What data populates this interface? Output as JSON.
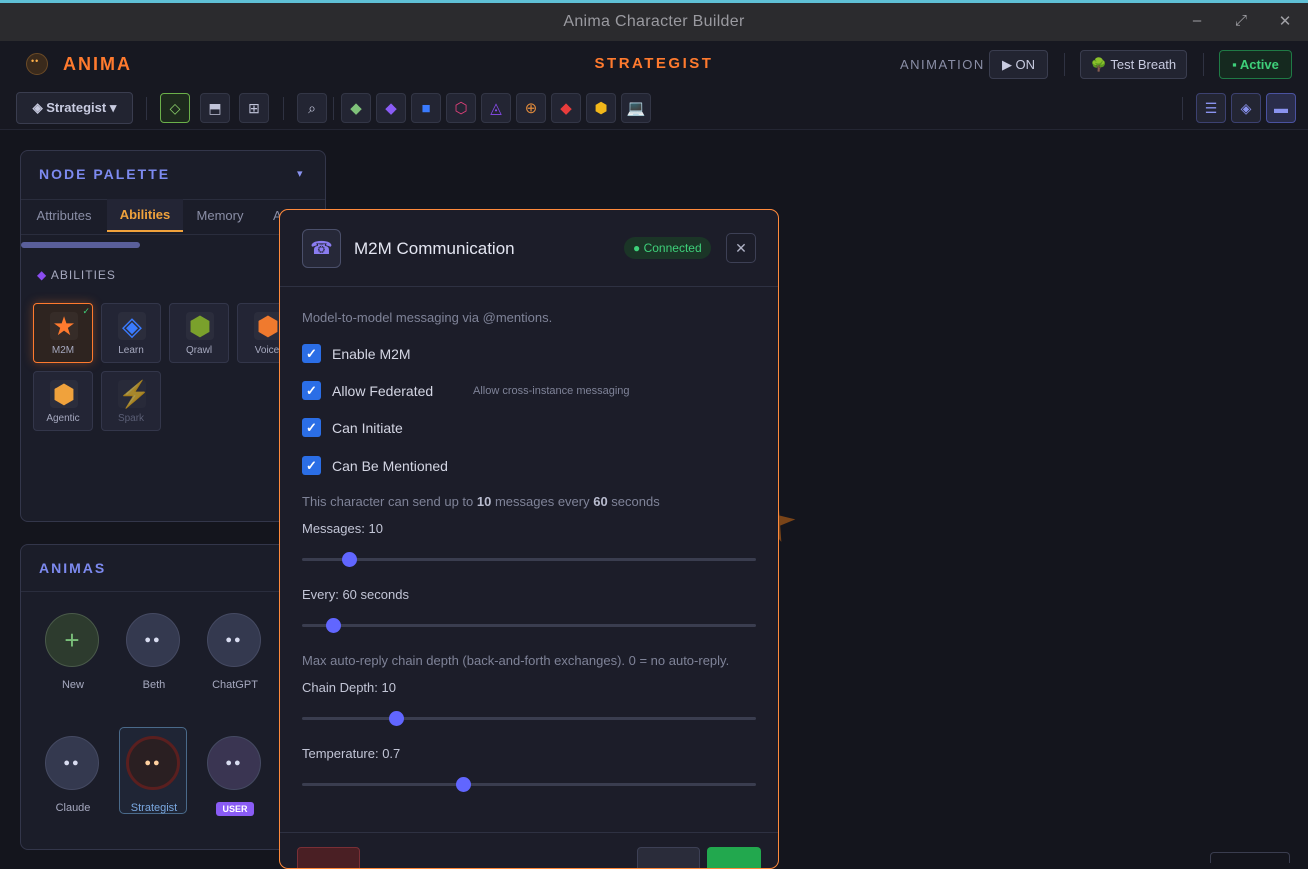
{
  "window": {
    "title": "Anima Character Builder",
    "min_icon": "minimize-icon",
    "max_icon": "maximize-icon",
    "close_icon": "close-icon"
  },
  "header": {
    "brand": "ANIMA",
    "center_title": "STRATEGIST",
    "animation_label": "ANIMATION",
    "animation_toggle": "▶ ON",
    "test_breath": "🌳 Test Breath",
    "status": "▪ Active"
  },
  "toolbar": {
    "character_select": "◈ Strategist ▾",
    "tools": [
      "◇",
      "⬒",
      "⊞",
      "⌕"
    ],
    "node_icons": [
      {
        "name": "green-gem-icon",
        "glyph": "◆",
        "color": "#7fc27a"
      },
      {
        "name": "purple-gem-icon",
        "glyph": "◆",
        "color": "#8a5cf5"
      },
      {
        "name": "blue-square-icon",
        "glyph": "■",
        "color": "#3a7bff"
      },
      {
        "name": "pink-hexagon-icon",
        "glyph": "⬡",
        "color": "#e0407a"
      },
      {
        "name": "violet-triangle-icon",
        "glyph": "◬",
        "color": "#8a4cf0"
      },
      {
        "name": "orange-crosshair-icon",
        "glyph": "⊕",
        "color": "#e08a3c"
      },
      {
        "name": "red-gem-icon",
        "glyph": "◆",
        "color": "#e83c3c"
      },
      {
        "name": "gold-hexagon-icon",
        "glyph": "⬢",
        "color": "#f2b71a"
      },
      {
        "name": "laptop-icon",
        "glyph": "💻",
        "color": "#7fc0e0"
      }
    ],
    "right_icons": [
      "☰",
      "◈",
      "▬"
    ]
  },
  "node_palette": {
    "title": "NODE PALETTE",
    "collapse_icon": "▾",
    "tabs": [
      "Attributes",
      "Abilities",
      "Memory",
      "Ad"
    ],
    "active_tab": "Abilities",
    "section": "ABILITIES",
    "abilities": [
      {
        "label": "M2M",
        "color": "#ff7a2e",
        "selected": true
      },
      {
        "label": "Learn",
        "color": "#3a7bff"
      },
      {
        "label": "Qrawl",
        "color": "#7aa12c"
      },
      {
        "label": "Voice",
        "color": "#f07a2e"
      },
      {
        "label": "Agentic",
        "color": "#f0a23c"
      },
      {
        "label": "Spark",
        "color": "#3a5bb0"
      }
    ]
  },
  "animas": {
    "title": "ANIMAS",
    "items": [
      {
        "label": "New"
      },
      {
        "label": "Beth"
      },
      {
        "label": "ChatGPT"
      },
      {
        "label": "Claude"
      },
      {
        "label": "Strategist"
      },
      {
        "label": "USER"
      }
    ]
  },
  "modal": {
    "icon": "☎",
    "title": "M2M Communication",
    "badge": "● Connected",
    "close": "✕",
    "description": "Model-to-model messaging via @mentions.",
    "checkboxes": [
      {
        "label": "Enable M2M",
        "checked": true
      },
      {
        "label": "Allow Federated",
        "checked": true,
        "hint": "Allow cross-instance messaging"
      },
      {
        "label": "Can Initiate",
        "checked": true
      },
      {
        "label": "Can Be Mentioned",
        "checked": true
      }
    ],
    "rate_text": {
      "prefix": "This character can send up to ",
      "messages": "10",
      "middle": " messages every ",
      "seconds": "60",
      "suffix": " seconds"
    },
    "sliders": [
      {
        "label": "Messages: 10",
        "fraction": 0.104
      },
      {
        "label": "Every: 60 seconds",
        "fraction": 0.068
      },
      {
        "label": "Chain Depth: 10",
        "fraction": 0.208
      },
      {
        "label": "Temperature: 0.7",
        "fraction": 0.355
      }
    ],
    "chain_note": "Max auto-reply chain depth (back-and-forth exchanges). 0 = no auto-reply."
  }
}
